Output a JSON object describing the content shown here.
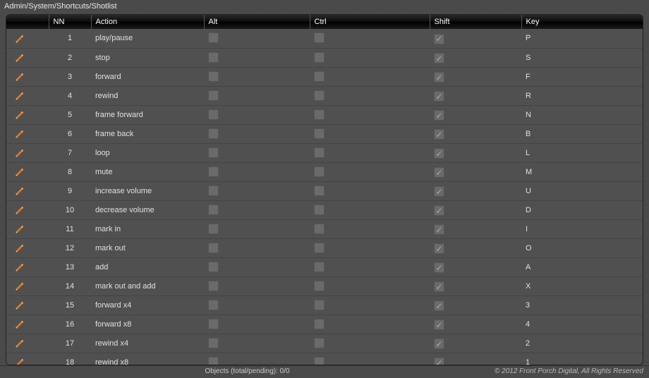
{
  "title": "Admin/System/Shortcuts/Shotlist",
  "columns": {
    "edit": "",
    "nn": "NN",
    "action": "Action",
    "alt": "Alt",
    "ctrl": "Ctrl",
    "shift": "Shift",
    "key": "Key"
  },
  "rows": [
    {
      "nn": "1",
      "action": "play/pause",
      "alt": false,
      "ctrl": false,
      "shift": true,
      "key": "P"
    },
    {
      "nn": "2",
      "action": "stop",
      "alt": false,
      "ctrl": false,
      "shift": true,
      "key": "S"
    },
    {
      "nn": "3",
      "action": "forward",
      "alt": false,
      "ctrl": false,
      "shift": true,
      "key": "F"
    },
    {
      "nn": "4",
      "action": "rewind",
      "alt": false,
      "ctrl": false,
      "shift": true,
      "key": "R"
    },
    {
      "nn": "5",
      "action": "frame forward",
      "alt": false,
      "ctrl": false,
      "shift": true,
      "key": "N"
    },
    {
      "nn": "6",
      "action": "frame back",
      "alt": false,
      "ctrl": false,
      "shift": true,
      "key": "B"
    },
    {
      "nn": "7",
      "action": "loop",
      "alt": false,
      "ctrl": false,
      "shift": true,
      "key": "L"
    },
    {
      "nn": "8",
      "action": "mute",
      "alt": false,
      "ctrl": false,
      "shift": true,
      "key": "M"
    },
    {
      "nn": "9",
      "action": "increase volume",
      "alt": false,
      "ctrl": false,
      "shift": true,
      "key": "U"
    },
    {
      "nn": "10",
      "action": "decrease volume",
      "alt": false,
      "ctrl": false,
      "shift": true,
      "key": "D"
    },
    {
      "nn": "11",
      "action": "mark in",
      "alt": false,
      "ctrl": false,
      "shift": true,
      "key": "I"
    },
    {
      "nn": "12",
      "action": "mark out",
      "alt": false,
      "ctrl": false,
      "shift": true,
      "key": "O"
    },
    {
      "nn": "13",
      "action": "add",
      "alt": false,
      "ctrl": false,
      "shift": true,
      "key": "A"
    },
    {
      "nn": "14",
      "action": "mark out and add",
      "alt": false,
      "ctrl": false,
      "shift": true,
      "key": "X"
    },
    {
      "nn": "15",
      "action": "forward x4",
      "alt": false,
      "ctrl": false,
      "shift": true,
      "key": "3"
    },
    {
      "nn": "16",
      "action": "forward x8",
      "alt": false,
      "ctrl": false,
      "shift": true,
      "key": "4"
    },
    {
      "nn": "17",
      "action": "rewind x4",
      "alt": false,
      "ctrl": false,
      "shift": true,
      "key": "2"
    },
    {
      "nn": "18",
      "action": "rewind x8",
      "alt": false,
      "ctrl": false,
      "shift": true,
      "key": "1"
    }
  ],
  "status": {
    "center": "Objects (total/pending): 0/0",
    "right": "© 2012 Front Porch Digital, All Rights Reserved"
  }
}
